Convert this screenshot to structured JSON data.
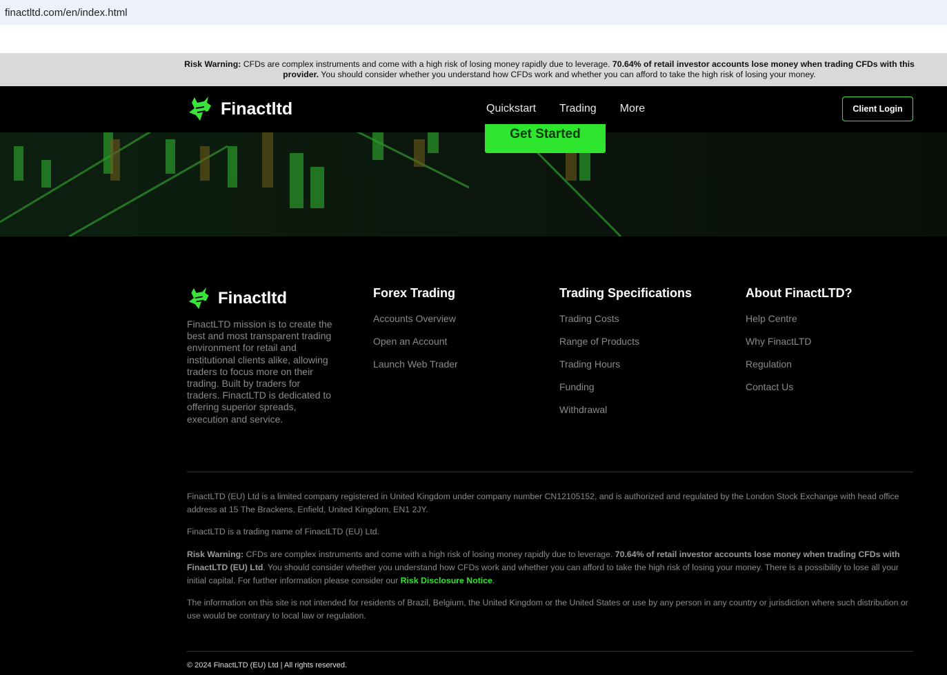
{
  "browser": {
    "url": "finactltd.com/en/index.html"
  },
  "risk_banner": {
    "label": "Risk Warning:",
    "text1": " CFDs are complex instruments and come with a high risk of losing money rapidly due to leverage. ",
    "bold": "70.64% of retail investor accounts lose money when trading CFDs with this provider.",
    "text2": " You should consider whether you understand how CFDs work and whether you can afford to take the high risk of losing your money."
  },
  "nav": {
    "logo": "Finactltd",
    "items": [
      "Quickstart",
      "Trading",
      "More"
    ],
    "login": "Client Login"
  },
  "hero": {
    "cta": "Get Started"
  },
  "footer": {
    "logo": "Finactltd",
    "mission": "FinactLTD mission is to create the best and most transparent trading environment for retail and institutional clients alike, allowing traders to focus more on their trading. Built by traders for traders. FinactLTD is dedicated to offering superior spreads, execution and service.",
    "columns": [
      {
        "title": "Forex Trading",
        "links": [
          "Accounts Overview",
          "Open an Account",
          "Launch Web Trader"
        ]
      },
      {
        "title": "Trading Specifications",
        "links": [
          "Trading Costs",
          "Range of Products",
          "Trading Hours",
          "Funding",
          "Withdrawal"
        ]
      },
      {
        "title": "About FinactLTD?",
        "links": [
          "Help Centre",
          "Why FinactLTD",
          "Regulation",
          "Contact Us"
        ]
      }
    ],
    "legal1": "FinactLTD (EU) Ltd is a limited company registered in United Kingdom under company number CN12105152, and is authorized and regulated by the London Stock Exchange with head office address at 15 The Brackens, Enfield, United Kingdom, EN1 2JY.",
    "legal2": "FinactLTD is a trading name of FinactLTD (EU) Ltd.",
    "risk_label": "Risk Warning:",
    "risk_text1": " CFDs are complex instruments and come with a high risk of losing money rapidly due to leverage. ",
    "risk_bold": "70.64% of retail investor accounts lose money when trading CFDs with FinactLTD (EU) Ltd",
    "risk_text2": ". You should consider whether you understand how CFDs work and whether you can afford to take the high risk of losing your money. There is a possibility to lose all your initial capital. For further information please consider our ",
    "risk_link": "Risk Disclosure Notice",
    "risk_end": ".",
    "legal4": "The information on this site is not intended for residents of Brazil, Belgium, the United Kingdom or the United States or use by any person in any country or jurisdiction where such distribution or use would be contrary to local law or regulation.",
    "copyright": "© 2024 FinactLTD (EU) Ltd | All rights reserved."
  },
  "colors": {
    "accent": "#2ee62e"
  }
}
